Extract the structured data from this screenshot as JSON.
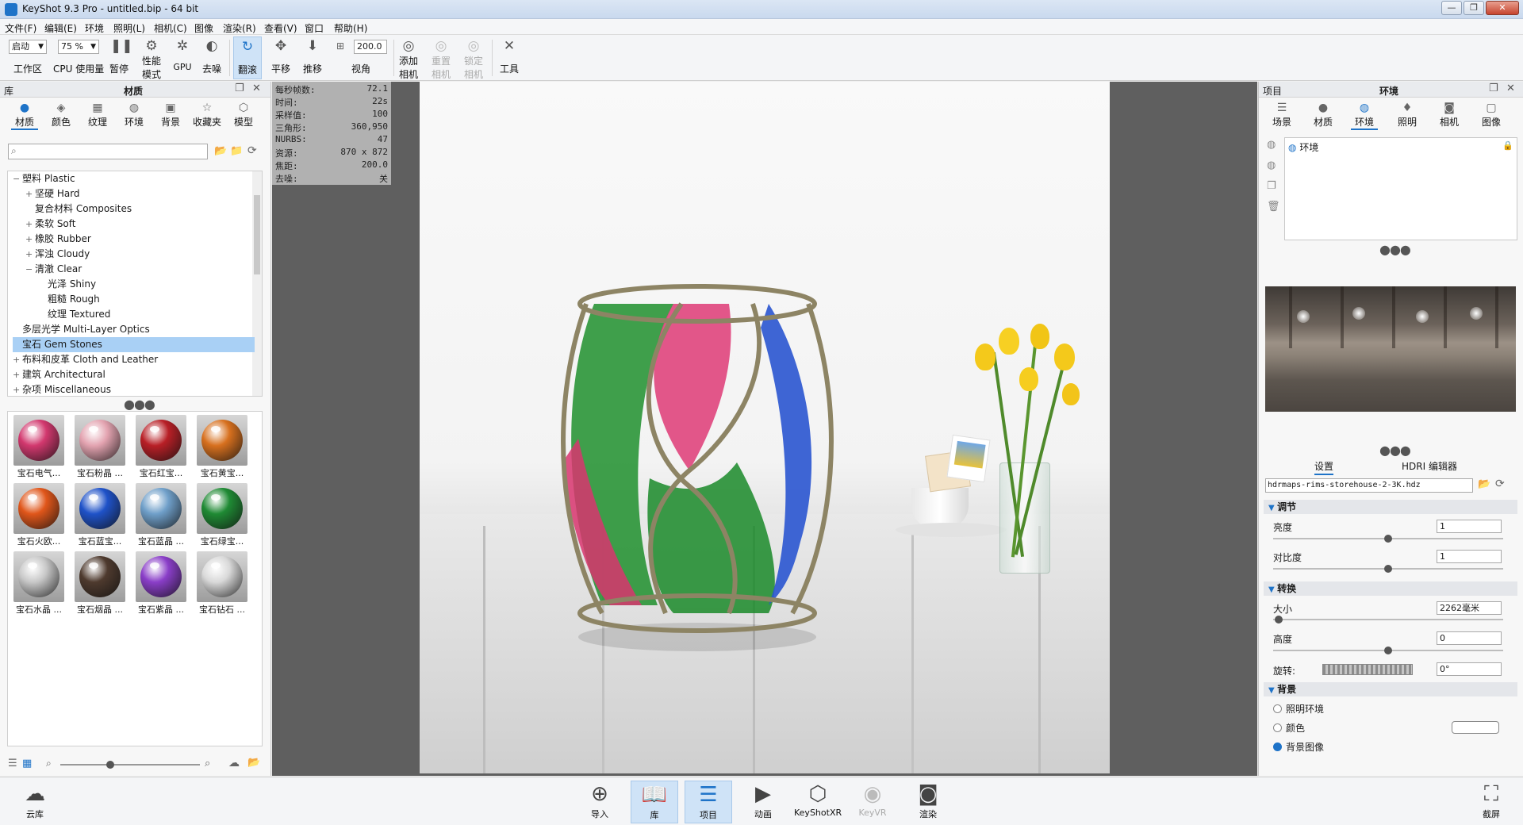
{
  "window": {
    "title": "KeyShot 9.3 Pro  - untitled.bip  - 64 bit",
    "controls": [
      "—",
      "❐",
      "✕"
    ]
  },
  "menu": [
    "文件(F)",
    "编辑(E)",
    "环境",
    "照明(L)",
    "相机(C)",
    "图像",
    "渲染(R)",
    "查看(V)",
    "窗口",
    "帮助(H)"
  ],
  "toolbar": {
    "workspace_value": "启动",
    "workspace_label": "工作区",
    "cpu_value": "75 %",
    "cpu_label": "CPU 使用量",
    "pause": "暂停",
    "perf1": "性能",
    "perf2": "模式",
    "gpu": "GPU",
    "denoise": "去噪",
    "tumble": "翻滚",
    "pan": "平移",
    "dolly": "推移",
    "fov_value": "200.0",
    "fov_label": "视角",
    "addcam1": "添加",
    "addcam2": "相机",
    "resetcam1": "重置",
    "resetcam2": "相机",
    "lockcam1": "锁定",
    "lockcam2": "相机",
    "tools": "工具"
  },
  "library": {
    "title_left": "库",
    "title_center": "材质",
    "tabs": [
      "材质",
      "颜色",
      "纹理",
      "环境",
      "背景",
      "收藏夹",
      "模型"
    ],
    "tree": [
      {
        "label": "塑料 Plastic",
        "pm": "−",
        "indent": 0
      },
      {
        "label": "坚硬 Hard",
        "pm": "+",
        "indent": 1
      },
      {
        "label": "复合材料 Composites",
        "pm": "",
        "indent": 1
      },
      {
        "label": "柔软 Soft",
        "pm": "+",
        "indent": 1
      },
      {
        "label": "橡胶 Rubber",
        "pm": "+",
        "indent": 1
      },
      {
        "label": "浑浊 Cloudy",
        "pm": "+",
        "indent": 1
      },
      {
        "label": "清澈 Clear",
        "pm": "−",
        "indent": 1
      },
      {
        "label": "光泽 Shiny",
        "pm": "",
        "indent": 2
      },
      {
        "label": "粗糙 Rough",
        "pm": "",
        "indent": 2
      },
      {
        "label": "纹理 Textured",
        "pm": "",
        "indent": 2
      },
      {
        "label": "多层光学 Multi-Layer Optics",
        "pm": "",
        "indent": 0
      },
      {
        "label": "宝石 Gem Stones",
        "pm": "",
        "indent": 0
      },
      {
        "label": "布料和皮革 Cloth and Leather",
        "pm": "+",
        "indent": 0
      },
      {
        "label": "建筑 Architectural",
        "pm": "+",
        "indent": 0
      },
      {
        "label": "杂项 Miscellaneous",
        "pm": "+",
        "indent": 0
      }
    ],
    "selected_index": 11,
    "thumbnails": [
      {
        "label": "宝石电气...",
        "color": "#d2386e"
      },
      {
        "label": "宝石粉晶 ...",
        "color": "#e3a3b0"
      },
      {
        "label": "宝石红宝...",
        "color": "#b81f26"
      },
      {
        "label": "宝石黄宝...",
        "color": "#d7701e"
      },
      {
        "label": "宝石火欧...",
        "color": "#e0561a"
      },
      {
        "label": "宝石蓝宝...",
        "color": "#1f52c8"
      },
      {
        "label": "宝石蓝晶 ...",
        "color": "#6f9fc9"
      },
      {
        "label": "宝石绿宝...",
        "color": "#1f8a34"
      },
      {
        "label": "宝石水晶 ...",
        "color": "#c8c8c8"
      },
      {
        "label": "宝石烟晶 ...",
        "color": "#4e3a2e"
      },
      {
        "label": "宝石紫晶 ...",
        "color": "#8a3ec8"
      },
      {
        "label": "宝石钻石 ...",
        "color": "#d9d9d9"
      }
    ]
  },
  "stats": [
    {
      "k": "每秒帧数:",
      "v": "72.1"
    },
    {
      "k": "时间:",
      "v": "22s"
    },
    {
      "k": "采样值:",
      "v": "100"
    },
    {
      "k": "三角形:",
      "v": "360,950"
    },
    {
      "k": "NURBS:",
      "v": "47"
    },
    {
      "k": "资源:",
      "v": "870 x 872"
    },
    {
      "k": "焦距:",
      "v": "200.0"
    },
    {
      "k": "去噪:",
      "v": "关"
    }
  ],
  "project": {
    "title_left": "项目",
    "title_center": "环境",
    "tabs": [
      "场景",
      "材质",
      "环境",
      "照明",
      "相机",
      "图像"
    ],
    "env_item": "环境",
    "subtabs": [
      "设置",
      "HDRI 编辑器"
    ],
    "hdri_file": "hdrmaps-rims-storehouse-2-3K.hdz",
    "sections": {
      "adjust": "调节",
      "transform": "转换",
      "background": "背景"
    },
    "brightness_label": "亮度",
    "brightness_value": "1",
    "contrast_label": "对比度",
    "contrast_value": "1",
    "size_label": "大小",
    "size_value": "2262毫米",
    "height_label": "高度",
    "height_value": "0",
    "rotation_label": "旋转:",
    "rotation_value": "0°",
    "bg_options": [
      "照明环境",
      "颜色",
      "背景图像"
    ],
    "bg_selected": 2
  },
  "bottombar": {
    "cloud": "云库",
    "import": "导入",
    "library": "库",
    "project": "项目",
    "animation": "动画",
    "keyshotxr": "KeyShotXR",
    "keyvr": "KeyVR",
    "render": "渲染",
    "screenshot": "截屏"
  }
}
